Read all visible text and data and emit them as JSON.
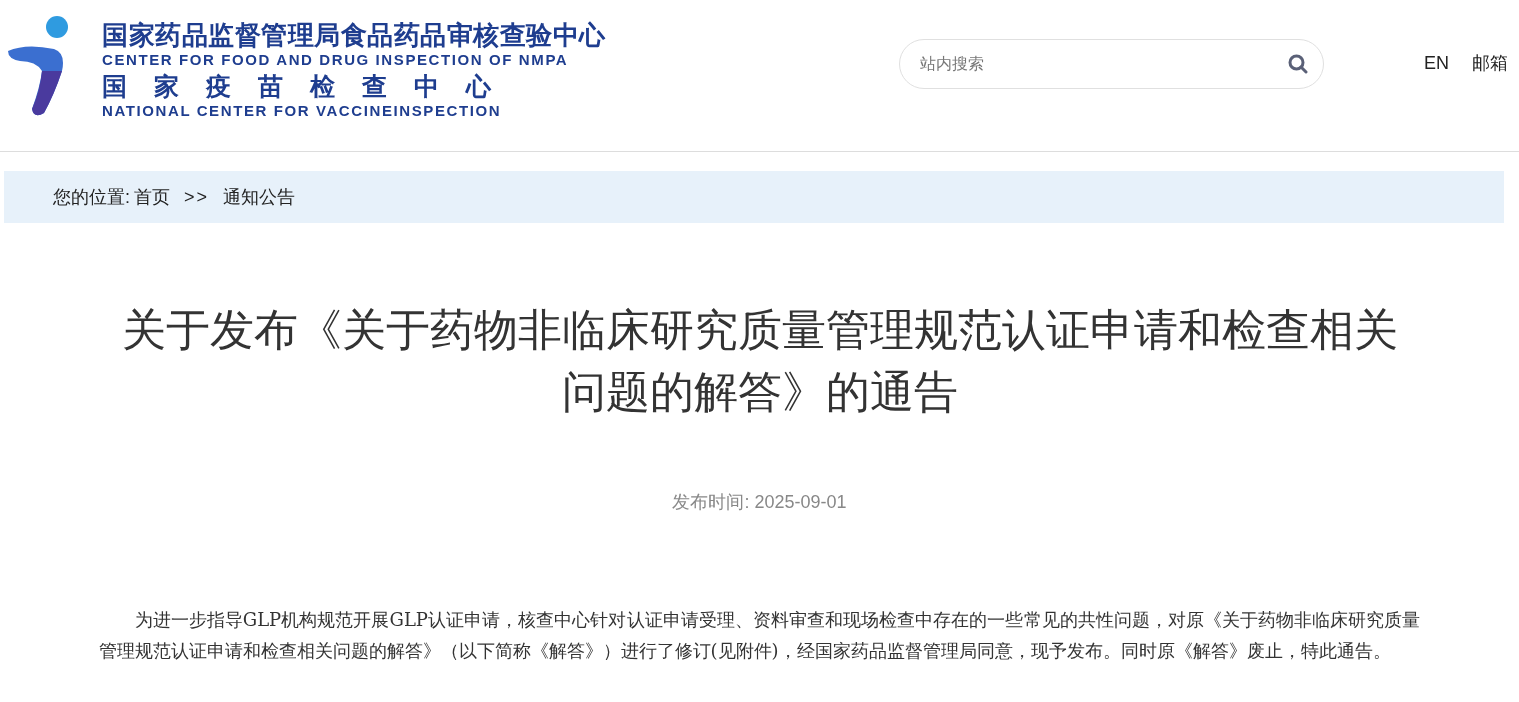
{
  "logo": {
    "title_cn": "国家药品监督管理局食品药品审核查验中心",
    "title_en": "CENTER FOR FOOD AND DRUG INSPECTION OF NMPA",
    "subtitle_cn": "国家疫苗检查中心",
    "subtitle_en": "NATIONAL CENTER FOR VACCINEINSPECTION"
  },
  "search": {
    "placeholder": "站内搜索"
  },
  "top_links": [
    "EN",
    "邮箱"
  ],
  "breadcrumb": {
    "label": "您的位置:",
    "items": [
      "首页",
      "通知公告"
    ],
    "separator": ">>"
  },
  "article": {
    "title": "关于发布《关于药物非临床研究质量管理规范认证申请和检查相关问题的解答》的通告",
    "date": "发布时间: 2025-09-01",
    "body": "为进一步指导GLP机构规范开展GLP认证申请，核查中心针对认证申请受理、资料审查和现场检查中存在的一些常见的共性问题，对原《关于药物非临床研究质量管理规范认证申请和检查相关问题的解答》（以下简称《解答》）进行了修订(见附件)，经国家药品监督管理局同意，现予发布。同时原《解答》废止，特此通告。"
  }
}
